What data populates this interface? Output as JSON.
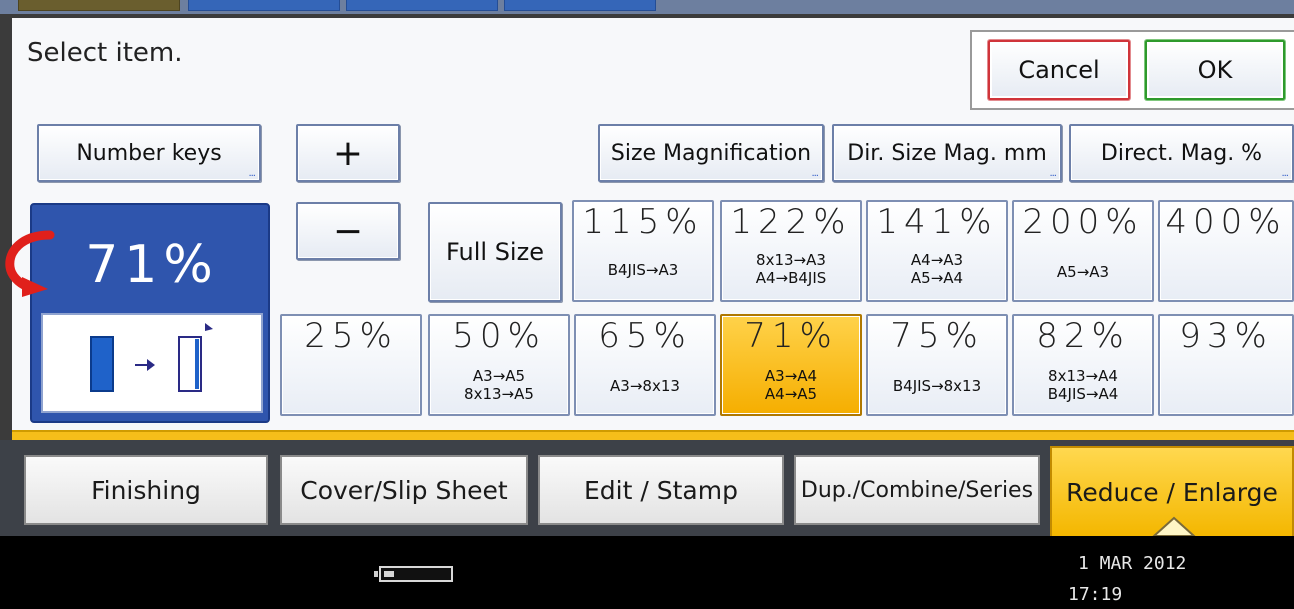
{
  "header": {
    "prompt": "Select item.",
    "cancel_label": "Cancel",
    "ok_label": "OK"
  },
  "toolbar": {
    "number_keys_label": "Number keys",
    "plus_label": "+",
    "minus_label": "−",
    "size_magnification_label": "Size Magnification",
    "dir_size_mag_label": "Dir. Size Mag. mm",
    "direct_mag_label": "Direct. Mag. %",
    "more_indicator": "..."
  },
  "current": {
    "percent": "71%"
  },
  "presets": {
    "full_size": "Full Size",
    "p115": {
      "pct": "115%",
      "line1": "B4JIS→A3",
      "line2": ""
    },
    "p122": {
      "pct": "122%",
      "line1": "8x13→A3",
      "line2": "A4→B4JIS"
    },
    "p141": {
      "pct": "141%",
      "line1": "A4→A3",
      "line2": "A5→A4"
    },
    "p200": {
      "pct": "200%",
      "line1": "A5→A3",
      "line2": ""
    },
    "p400": {
      "pct": "400%",
      "line1": "",
      "line2": ""
    },
    "p25": {
      "pct": "25%",
      "line1": "",
      "line2": ""
    },
    "p50": {
      "pct": "50%",
      "line1": "A3→A5",
      "line2": "8x13→A5"
    },
    "p65": {
      "pct": "65%",
      "line1": "A3→8x13",
      "line2": ""
    },
    "p71": {
      "pct": "71%",
      "line1": "A3→A4",
      "line2": "A4→A5"
    },
    "p75": {
      "pct": "75%",
      "line1": "B4JIS→8x13",
      "line2": ""
    },
    "p82": {
      "pct": "82%",
      "line1": "8x13→A4",
      "line2": "B4JIS→A4"
    },
    "p93": {
      "pct": "93%",
      "line1": "",
      "line2": ""
    }
  },
  "tabs": [
    {
      "label": "Finishing"
    },
    {
      "label": "Cover/Slip Sheet"
    },
    {
      "label": "Edit / Stamp"
    },
    {
      "label": "Dup./Combine/Series"
    },
    {
      "label": "Reduce / Enlarge"
    }
  ],
  "status": {
    "date": "1 MAR  2012",
    "time": "17:19"
  },
  "colors": {
    "accent_blue": "#2f55ad",
    "selected_yellow": "#f5ae00",
    "cancel_red": "#d0343a",
    "ok_green": "#2e9a2c",
    "rotate_arrow_red": "#e0201b"
  },
  "icons": {
    "rotate": "curved-arrow-icon",
    "orientation": "portrait-to-landscape-icon",
    "memory": "memory-bar-icon"
  }
}
